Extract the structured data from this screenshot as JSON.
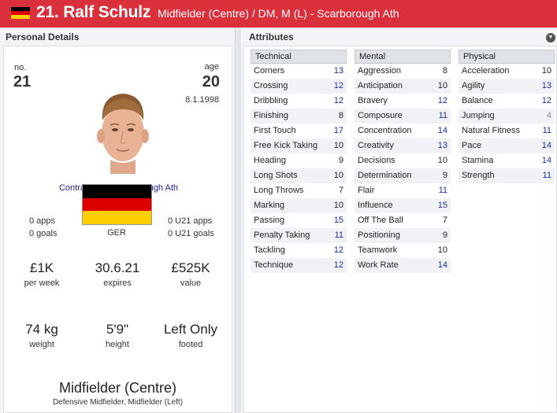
{
  "header": {
    "title": "21. Ralf Schulz",
    "subtitle": "Midfielder (Centre) / DM, M (L) - Scarborough Ath",
    "flag_colors": [
      "#000000",
      "#dd0000",
      "#ffce00"
    ]
  },
  "personal": {
    "panel_title": "Personal Details",
    "no_label": "no.",
    "no_value": "21",
    "age_label": "age",
    "age_value": "20",
    "dob": "8.1.1998",
    "contract_text": "Contracted to Scarborough Ath",
    "apps": "0 apps",
    "goals": "0 goals",
    "u21_apps": "0 U21 apps",
    "u21_goals": "0 U21 goals",
    "nationality": "GER",
    "wage_value": "£1K",
    "wage_label": "per week",
    "expires_value": "30.6.21",
    "expires_label": "expires",
    "value_value": "£525K",
    "value_label": "value",
    "weight_value": "74 kg",
    "weight_label": "weight",
    "height_value": "5'9\"",
    "height_label": "height",
    "footed_value": "Left Only",
    "footed_label": "footed",
    "position_main": "Midfielder (Centre)",
    "position_sub": "Defensive Midfielder, Midfielder (Left)"
  },
  "attributes": {
    "panel_title": "Attributes",
    "technical": {
      "title": "Technical",
      "items": [
        {
          "name": "Corners",
          "value": "13"
        },
        {
          "name": "Crossing",
          "value": "12"
        },
        {
          "name": "Dribbling",
          "value": "12"
        },
        {
          "name": "Finishing",
          "value": "8"
        },
        {
          "name": "First Touch",
          "value": "17"
        },
        {
          "name": "Free Kick Taking",
          "value": "10"
        },
        {
          "name": "Heading",
          "value": "9"
        },
        {
          "name": "Long Shots",
          "value": "10"
        },
        {
          "name": "Long Throws",
          "value": "7"
        },
        {
          "name": "Marking",
          "value": "10"
        },
        {
          "name": "Passing",
          "value": "15"
        },
        {
          "name": "Penalty Taking",
          "value": "11"
        },
        {
          "name": "Tackling",
          "value": "12"
        },
        {
          "name": "Technique",
          "value": "12"
        }
      ]
    },
    "mental": {
      "title": "Mental",
      "items": [
        {
          "name": "Aggression",
          "value": "8"
        },
        {
          "name": "Anticipation",
          "value": "10"
        },
        {
          "name": "Bravery",
          "value": "12"
        },
        {
          "name": "Composure",
          "value": "11"
        },
        {
          "name": "Concentration",
          "value": "14"
        },
        {
          "name": "Creativity",
          "value": "13"
        },
        {
          "name": "Decisions",
          "value": "10"
        },
        {
          "name": "Determination",
          "value": "9"
        },
        {
          "name": "Flair",
          "value": "11"
        },
        {
          "name": "Influence",
          "value": "15"
        },
        {
          "name": "Off The Ball",
          "value": "7"
        },
        {
          "name": "Positioning",
          "value": "9"
        },
        {
          "name": "Teamwork",
          "value": "10"
        },
        {
          "name": "Work Rate",
          "value": "14"
        }
      ]
    },
    "physical": {
      "title": "Physical",
      "items": [
        {
          "name": "Acceleration",
          "value": "10"
        },
        {
          "name": "Agility",
          "value": "13"
        },
        {
          "name": "Balance",
          "value": "12"
        },
        {
          "name": "Jumping",
          "value": "4"
        },
        {
          "name": "Natural Fitness",
          "value": "11"
        },
        {
          "name": "Pace",
          "value": "14"
        },
        {
          "name": "Stamina",
          "value": "14"
        },
        {
          "name": "Strength",
          "value": "11"
        }
      ]
    }
  }
}
